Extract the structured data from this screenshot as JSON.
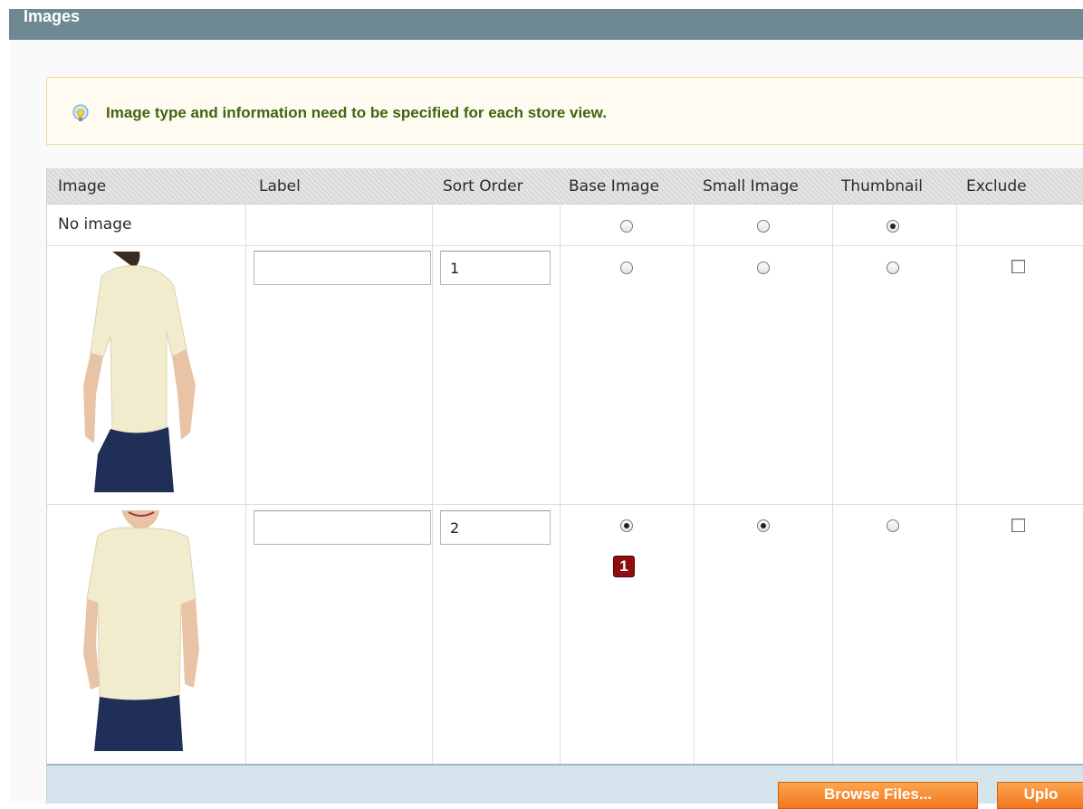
{
  "section": {
    "title": "Images"
  },
  "notice": {
    "icon": "lightbulb-icon",
    "message": "Image type and information need to be specified for each store view."
  },
  "columns": [
    "Image",
    "Label",
    "Sort Order",
    "Base Image",
    "Small Image",
    "Thumbnail",
    "Exclude"
  ],
  "rows": [
    {
      "image": "No image",
      "label": "",
      "sort_order": "",
      "base_image": false,
      "small_image": false,
      "thumbnail": true,
      "exclude": null
    },
    {
      "image": "t-shirt-back-photo",
      "label": "",
      "sort_order": "1",
      "base_image": false,
      "small_image": false,
      "thumbnail": false,
      "exclude": false
    },
    {
      "image": "t-shirt-front-photo",
      "label": "",
      "sort_order": "2",
      "base_image": true,
      "small_image": true,
      "thumbnail": false,
      "exclude": false
    }
  ],
  "badge": {
    "text": "1"
  },
  "buttons": {
    "browse": "Browse Files...",
    "upload": "Uplo"
  },
  "colors": {
    "header": "#6f8992",
    "notice_text": "#3d6611",
    "button": "#f1771e",
    "badge": "#8b0f0f"
  }
}
